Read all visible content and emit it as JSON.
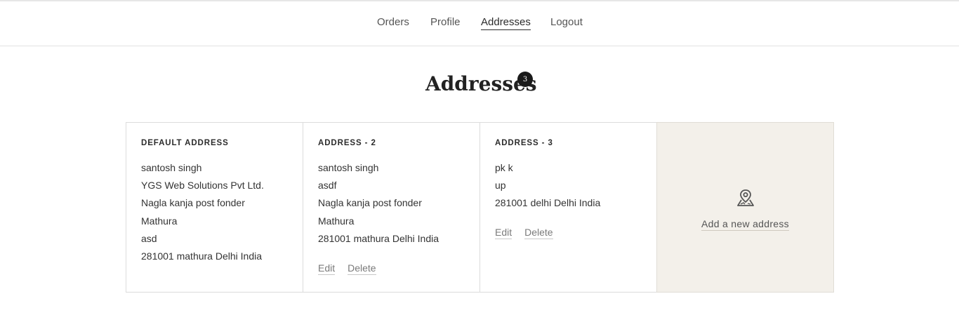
{
  "nav": {
    "items": [
      {
        "label": "Orders",
        "active": false
      },
      {
        "label": "Profile",
        "active": false
      },
      {
        "label": "Addresses",
        "active": true
      },
      {
        "label": "Logout",
        "active": false
      }
    ]
  },
  "page": {
    "title": "Addresses",
    "count": "3"
  },
  "addresses": [
    {
      "heading": "DEFAULT ADDRESS",
      "lines": [
        "santosh singh",
        "YGS Web Solutions Pvt Ltd.",
        "Nagla kanja post fonder",
        "Mathura",
        "asd",
        "281001 mathura Delhi India"
      ],
      "edit_label": "",
      "delete_label": ""
    },
    {
      "heading": "ADDRESS - 2",
      "lines": [
        "santosh singh",
        "asdf",
        "Nagla kanja post fonder",
        "Mathura",
        "281001 mathura Delhi India"
      ],
      "edit_label": "Edit",
      "delete_label": "Delete"
    },
    {
      "heading": "ADDRESS - 3",
      "lines": [
        "pk k",
        "up",
        "281001 delhi Delhi India"
      ],
      "edit_label": "Edit",
      "delete_label": "Delete"
    }
  ],
  "add_new": {
    "label": "Add a new address",
    "icon": "map-pin-icon"
  }
}
